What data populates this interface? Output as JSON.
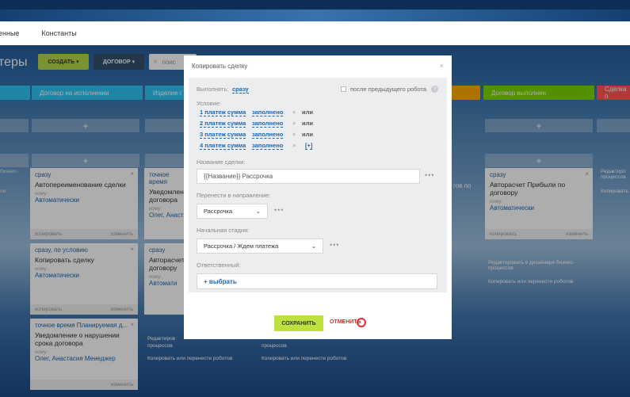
{
  "menu": [
    "енные",
    "Константы"
  ],
  "page": {
    "title": "теры",
    "create_btn": "СОЗДАТЬ",
    "deal_btn": "ДОГОВОР",
    "search_placeholder": "поис"
  },
  "stages": [
    {
      "label": "Договор на исполнении",
      "color": "#2fc6f6"
    },
    {
      "label": "Изделие г",
      "color": "#2fc6f6"
    },
    {
      "label": "Договор выполнен",
      "color": "#7bd500"
    },
    {
      "label": "Сделка п",
      "color": "#ff5752"
    }
  ],
  "cards": [
    {
      "title": "сразу",
      "body": "Автопереименование сделки",
      "for_label": "кому:",
      "resp": "Автоматически",
      "copy": "копировать",
      "edit": "изменить"
    },
    {
      "title": "точное время",
      "body": "Уведомлен договора",
      "for_label": "кому:",
      "resp": "Олег, Анаст"
    },
    {
      "title": "сразу, по условию",
      "body": "Копировать сделку",
      "for_label": "кому:",
      "resp": "Автоматически",
      "copy": "копировать",
      "edit": "изменить"
    },
    {
      "title": "сразу",
      "body": "Авторасчет договору",
      "for_label": "кому:",
      "resp": "Автомати"
    },
    {
      "title": "точное время Планируемая д...",
      "body": "Уведомление о нарушении срока договора",
      "for_label": "кому:",
      "resp": "Олег, Анастасия Менеджер",
      "edit": "изменить"
    },
    {
      "title": "сразу",
      "body": "Авторасчет Прибыли по договору",
      "for_label": "кому:",
      "resp": "Автоматически",
      "copy": "копировать",
      "edit": "изменить"
    }
  ],
  "ghost": {
    "left_a": "бизнес-",
    "left_b": "ов",
    "edit_designer": "Редактировать в дизайнере бизнес-процессов",
    "redact": "Редактиров",
    "processes": "процессов",
    "copy_move": "Копировать или перенести роботов",
    "copy_move_short": "Копировать или",
    "right_top": "Редактиро процессов",
    "right_copy": "Копировать",
    "mid": "гов по"
  },
  "dialog": {
    "title": "Копировать сделку",
    "execute_label": "Выполнять:",
    "execute_value": "сразу",
    "after_prev": "после предыдущего робота",
    "condition_label": "Условие:",
    "conditions": [
      {
        "field": "1 платеж сумма",
        "op": "заполнено",
        "joiner": "или"
      },
      {
        "field": "2 платеж сумма",
        "op": "заполнено",
        "joiner": "или"
      },
      {
        "field": "3 платеж сумма",
        "op": "заполнено",
        "joiner": "или"
      },
      {
        "field": "4 платеж сумма",
        "op": "заполнено",
        "joiner": "[+]"
      }
    ],
    "deal_name_label": "Название сделки:",
    "deal_name_value": "{{Название}} Рассрочка",
    "direction_label": "Перенести в направление:",
    "direction_value": "Рассрочка",
    "stage_label": "Начальная стадия:",
    "stage_value": "Рассрочка / Ждем платежа",
    "responsible_label": "Ответственный:",
    "responsible_value": "+ выбрать",
    "save": "СОХРАНИТЬ",
    "cancel": "ОТМЕНИТЬ"
  }
}
